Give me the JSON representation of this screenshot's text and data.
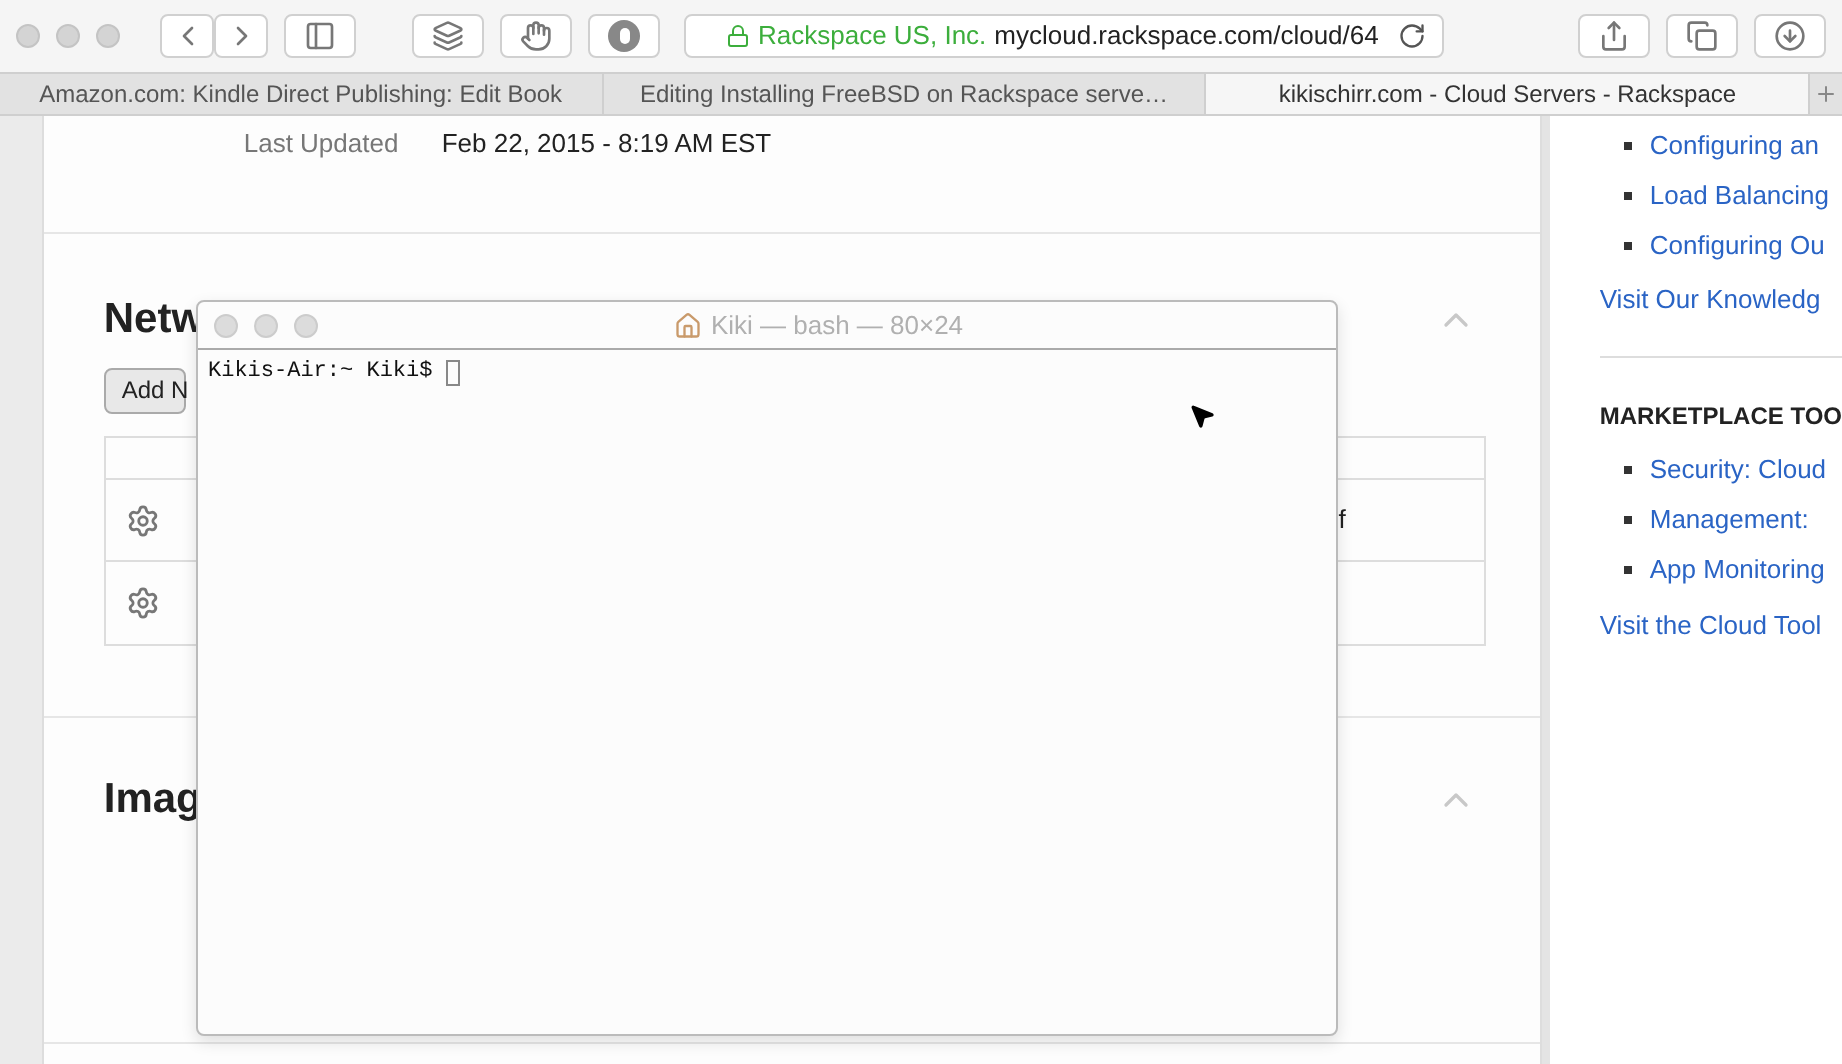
{
  "browser": {
    "toolbar": {
      "secure_site": "Rackspace US, Inc.",
      "url": "mycloud.rackspace.com/cloud/64"
    },
    "tabs": [
      {
        "label": "Amazon.com: Kindle Direct Publishing: Edit Book",
        "selected": false
      },
      {
        "label": "Editing Installing FreeBSD on Rackspace serve…",
        "selected": false
      },
      {
        "label": "kikischirr.com - Cloud Servers - Rackspace",
        "selected": true
      }
    ]
  },
  "page": {
    "details": [
      {
        "label": "Last Updated",
        "value": "Feb 22, 2015 - 8:19 AM EST"
      }
    ],
    "networks": {
      "heading": "Netw",
      "expanded": true,
      "add_button": "Add N",
      "rows": [
        {
          "kind": "text",
          "cell": "f"
        },
        {
          "kind": "blank"
        }
      ]
    },
    "images": {
      "heading": "Imag",
      "expanded": true
    }
  },
  "sidebar": {
    "sections": [
      {
        "links": [
          "Configuring an",
          "Load Balancing",
          "Configuring Ou"
        ],
        "more_link": "Visit Our Knowledg"
      },
      {
        "heading": "MARKETPLACE TOO",
        "links": [
          "Security: Cloud",
          "Management:",
          "App Monitoring"
        ],
        "more_link": "Visit the Cloud Tool"
      }
    ]
  },
  "terminal": {
    "title": "Kiki — bash — 80×24",
    "prompt": "Kikis-Air:~ Kiki$"
  }
}
